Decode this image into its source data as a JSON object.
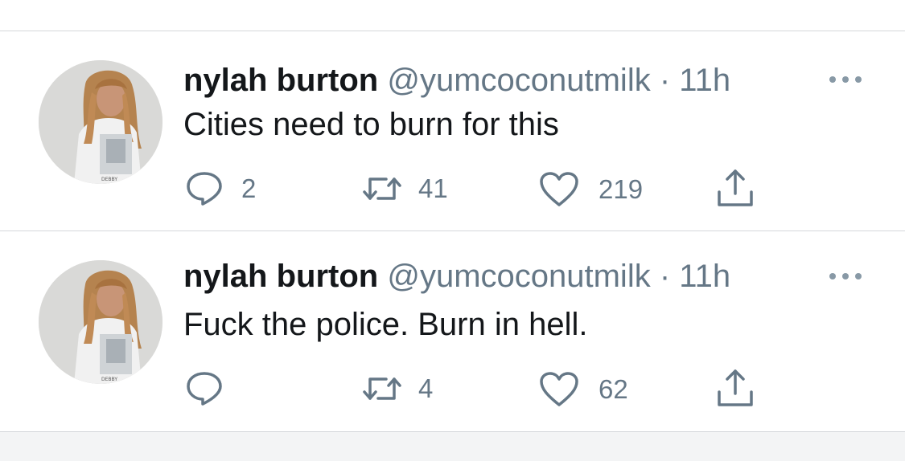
{
  "tweets": [
    {
      "display_name": "nylah burton",
      "handle": "@yumcoconutmilk",
      "separator": "·",
      "time": "11h",
      "text": "Cities need to burn for this",
      "reply_count": "2",
      "retweet_count": "41",
      "like_count": "219",
      "avatar_shirt_text": "DEBBY"
    },
    {
      "display_name": "nylah burton",
      "handle": "@yumcoconutmilk",
      "separator": "·",
      "time": "11h",
      "text": "Fuck the police. Burn in hell.",
      "reply_count": "",
      "retweet_count": "4",
      "like_count": "62",
      "avatar_shirt_text": "DEBBY"
    }
  ],
  "icons": {
    "reply": "speech-bubble-icon",
    "retweet": "retweet-arrows-icon",
    "like": "heart-outline-icon",
    "share": "share-upload-icon",
    "more": "ellipsis-icon"
  },
  "colors": {
    "text_primary": "#14171a",
    "text_secondary": "#657786",
    "divider": "#d4d7da",
    "icon": "#657786"
  }
}
